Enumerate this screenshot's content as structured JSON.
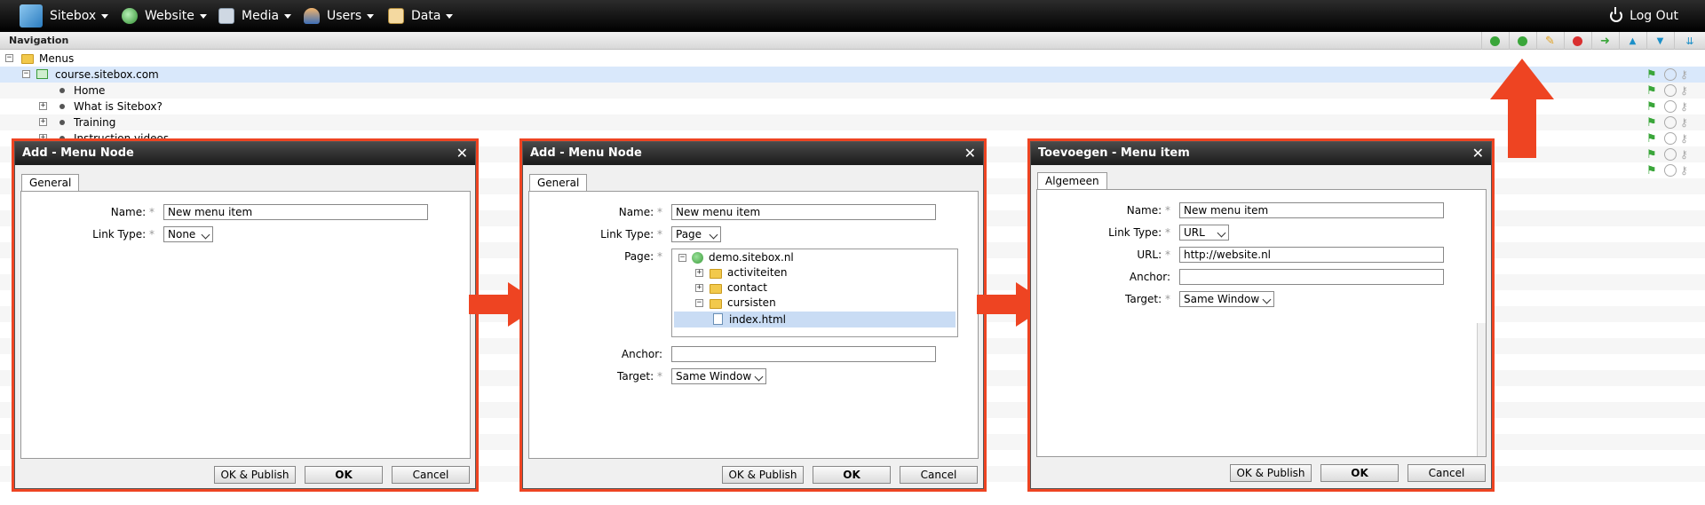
{
  "topbar": {
    "menus": [
      {
        "label": "Sitebox",
        "icon": "cube-icon"
      },
      {
        "label": "Website",
        "icon": "globe-icon"
      },
      {
        "label": "Media",
        "icon": "media-icon"
      },
      {
        "label": "Users",
        "icon": "users-icon"
      },
      {
        "label": "Data",
        "icon": "data-icon"
      }
    ],
    "logout": "Log Out"
  },
  "navigation": {
    "title": "Navigation",
    "tree": {
      "root": "Menus",
      "site": "course.sitebox.com",
      "items": [
        "Home",
        "What is Sitebox?",
        "Training",
        "Instruction videos"
      ]
    }
  },
  "dialogs": [
    {
      "title": "Add - Menu Node",
      "tab": "General",
      "name_label": "Name:",
      "name_value": "New menu item",
      "linktype_label": "Link Type:",
      "linktype_value": "None",
      "buttons": {
        "publish": "OK & Publish",
        "ok": "OK",
        "cancel": "Cancel"
      }
    },
    {
      "title": "Add - Menu Node",
      "tab": "General",
      "name_label": "Name:",
      "name_value": "New menu item",
      "linktype_label": "Link Type:",
      "linktype_value": "Page",
      "page_label": "Page:",
      "page_tree": {
        "root": "demo.sitebox.nl",
        "folders": [
          "activiteiten",
          "contact",
          "cursisten"
        ],
        "file": "index.html"
      },
      "anchor_label": "Anchor:",
      "target_label": "Target:",
      "target_value": "Same Window",
      "buttons": {
        "publish": "OK & Publish",
        "ok": "OK",
        "cancel": "Cancel"
      }
    },
    {
      "title": "Toevoegen - Menu item",
      "tab": "Algemeen",
      "name_label": "Name:",
      "name_value": "New menu item",
      "linktype_label": "Link Type:",
      "linktype_value": "URL",
      "url_label": "URL:",
      "url_value": "http://website.nl",
      "anchor_label": "Anchor:",
      "target_label": "Target:",
      "target_value": "Same Window",
      "buttons": {
        "publish": "OK & Publish",
        "ok": "OK",
        "cancel": "Cancel"
      }
    }
  ],
  "colors": {
    "accent": "#ee4422",
    "selected_row": "#d9e8fb"
  }
}
